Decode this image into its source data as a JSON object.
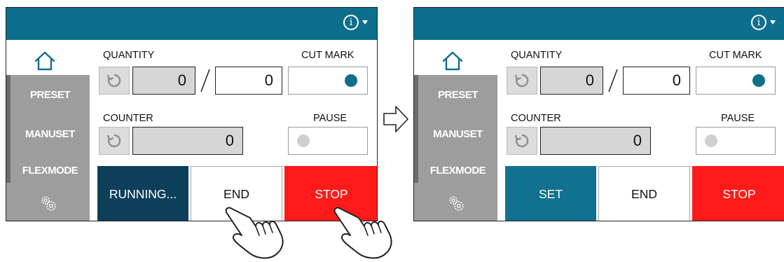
{
  "colors": {
    "header": "#0e6f8d",
    "running": "#0d3f5b",
    "set": "#11718f",
    "stop": "#ff1a1a",
    "cut_mark_on": "#0e6f8d",
    "pause_off": "#cfcfcf"
  },
  "icons": {
    "info": "info-circle-icon",
    "home": "home-icon",
    "reset": "reset-icon",
    "settings": "gears-icon",
    "arrow": "right-arrow-icon",
    "hand": "pointing-hand-icon"
  },
  "screens": [
    {
      "info_symbol": "i",
      "sidebar": [
        "PRESET",
        "MANUSET",
        "FLEXMODE"
      ],
      "quantity_label": "QUANTITY",
      "quantity_current": "0",
      "quantity_target": "0",
      "cut_mark_label": "CUT MARK",
      "cut_mark_on": true,
      "counter_label": "COUNTER",
      "counter_value": "0",
      "pause_label": "PAUSE",
      "pause_on": false,
      "buttons": [
        "RUNNING...",
        "END",
        "STOP"
      ],
      "first_button_state": "running"
    },
    {
      "info_symbol": "i",
      "sidebar": [
        "PRESET",
        "MANUSET",
        "FLEXMODE"
      ],
      "quantity_label": "QUANTITY",
      "quantity_current": "0",
      "quantity_target": "0",
      "cut_mark_label": "CUT MARK",
      "cut_mark_on": true,
      "counter_label": "COUNTER",
      "counter_value": "0",
      "pause_label": "PAUSE",
      "pause_on": false,
      "buttons": [
        "SET",
        "END",
        "STOP"
      ],
      "first_button_state": "set"
    }
  ]
}
